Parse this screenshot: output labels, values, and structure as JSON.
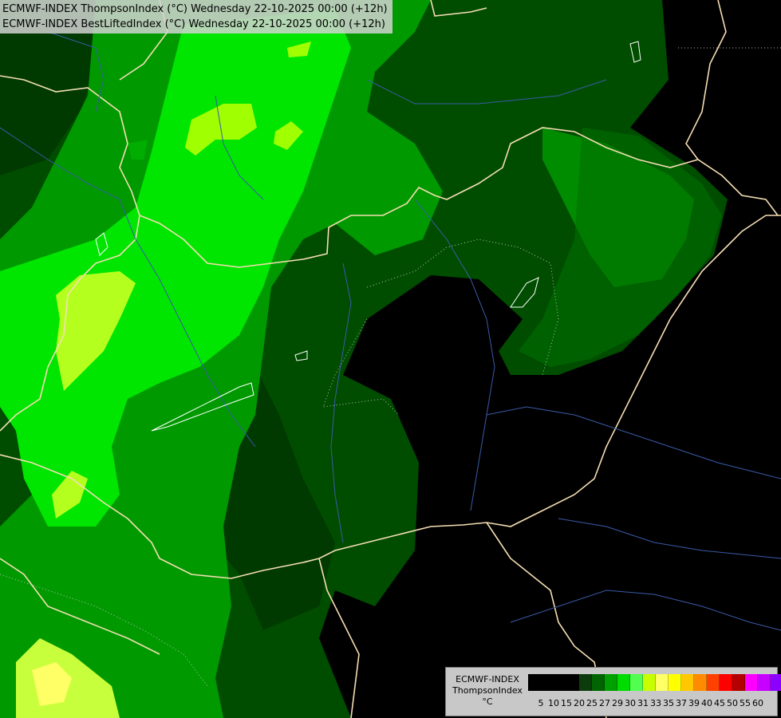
{
  "header": {
    "line1": "ECMWF-INDEX ThompsonIndex (°C) Wednesday 22-10-2025 00:00 (+12h)",
    "line2": "ECMWF-INDEX BestLiftedIndex (°C) Wednesday 22-10-2025 00:00 (+12h)"
  },
  "legend": {
    "title1": "ECMWF-INDEX",
    "title2": "ThompsonIndex",
    "unit": "°C",
    "colors": [
      "#000000",
      "#000000",
      "#000000",
      "#000000",
      "#0c3c0c",
      "#006400",
      "#00a000",
      "#00dc00",
      "#50ff50",
      "#c8ff00",
      "#ffff66",
      "#ffff00",
      "#ffc800",
      "#ff8c00",
      "#ff4000",
      "#ff0000",
      "#b40000",
      "#ff00ff",
      "#c800ff",
      "#8c00ff",
      "#4000ff",
      "#0000ff"
    ],
    "ticks": [
      "5",
      "10",
      "15",
      "20",
      "25",
      "27",
      "29",
      "30",
      "31",
      "33",
      "35",
      "37",
      "39",
      "40",
      "45",
      "50",
      "55",
      "60"
    ]
  }
}
